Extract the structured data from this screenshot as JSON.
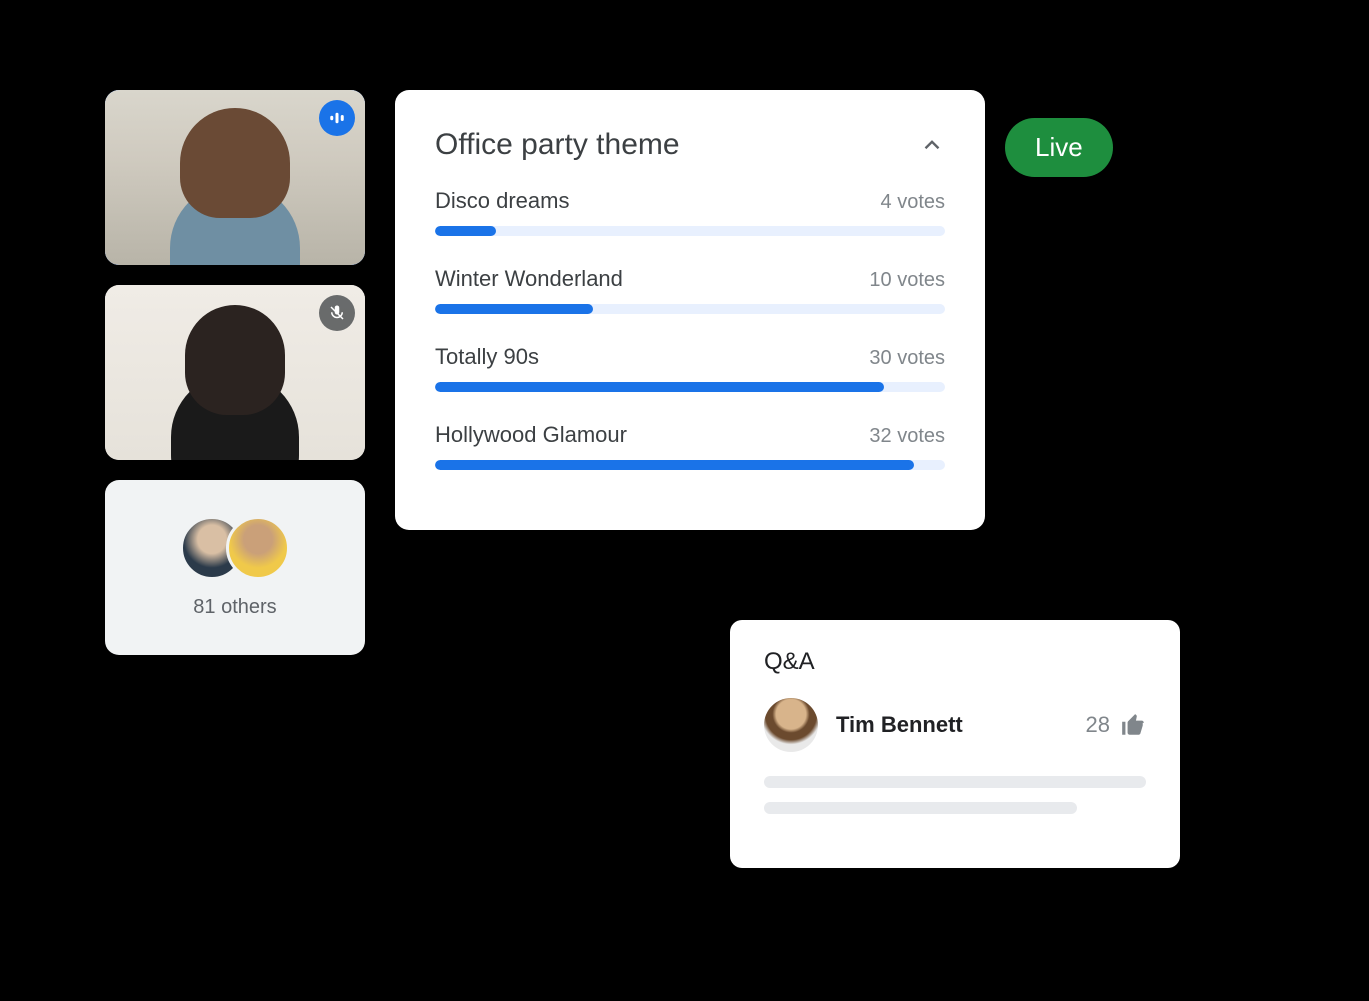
{
  "participants": {
    "others_label": "81 others"
  },
  "live_badge": "Live",
  "poll": {
    "title": "Office party theme",
    "options": [
      {
        "label": "Disco dreams",
        "votes_text": "4 votes",
        "pct": 12
      },
      {
        "label": "Winter Wonderland",
        "votes_text": "10 votes",
        "pct": 31
      },
      {
        "label": "Totally 90s",
        "votes_text": "30 votes",
        "pct": 88
      },
      {
        "label": "Hollywood Glamour",
        "votes_text": "32 votes",
        "pct": 94
      }
    ]
  },
  "qa": {
    "title": "Q&A",
    "entry": {
      "name": "Tim Bennett",
      "likes": "28"
    }
  },
  "chart_data": {
    "type": "bar",
    "title": "Office party theme",
    "categories": [
      "Disco dreams",
      "Winter Wonderland",
      "Totally 90s",
      "Hollywood Glamour"
    ],
    "values": [
      4,
      10,
      30,
      32
    ],
    "xlabel": "",
    "ylabel": "votes",
    "ylim": [
      0,
      35
    ]
  }
}
